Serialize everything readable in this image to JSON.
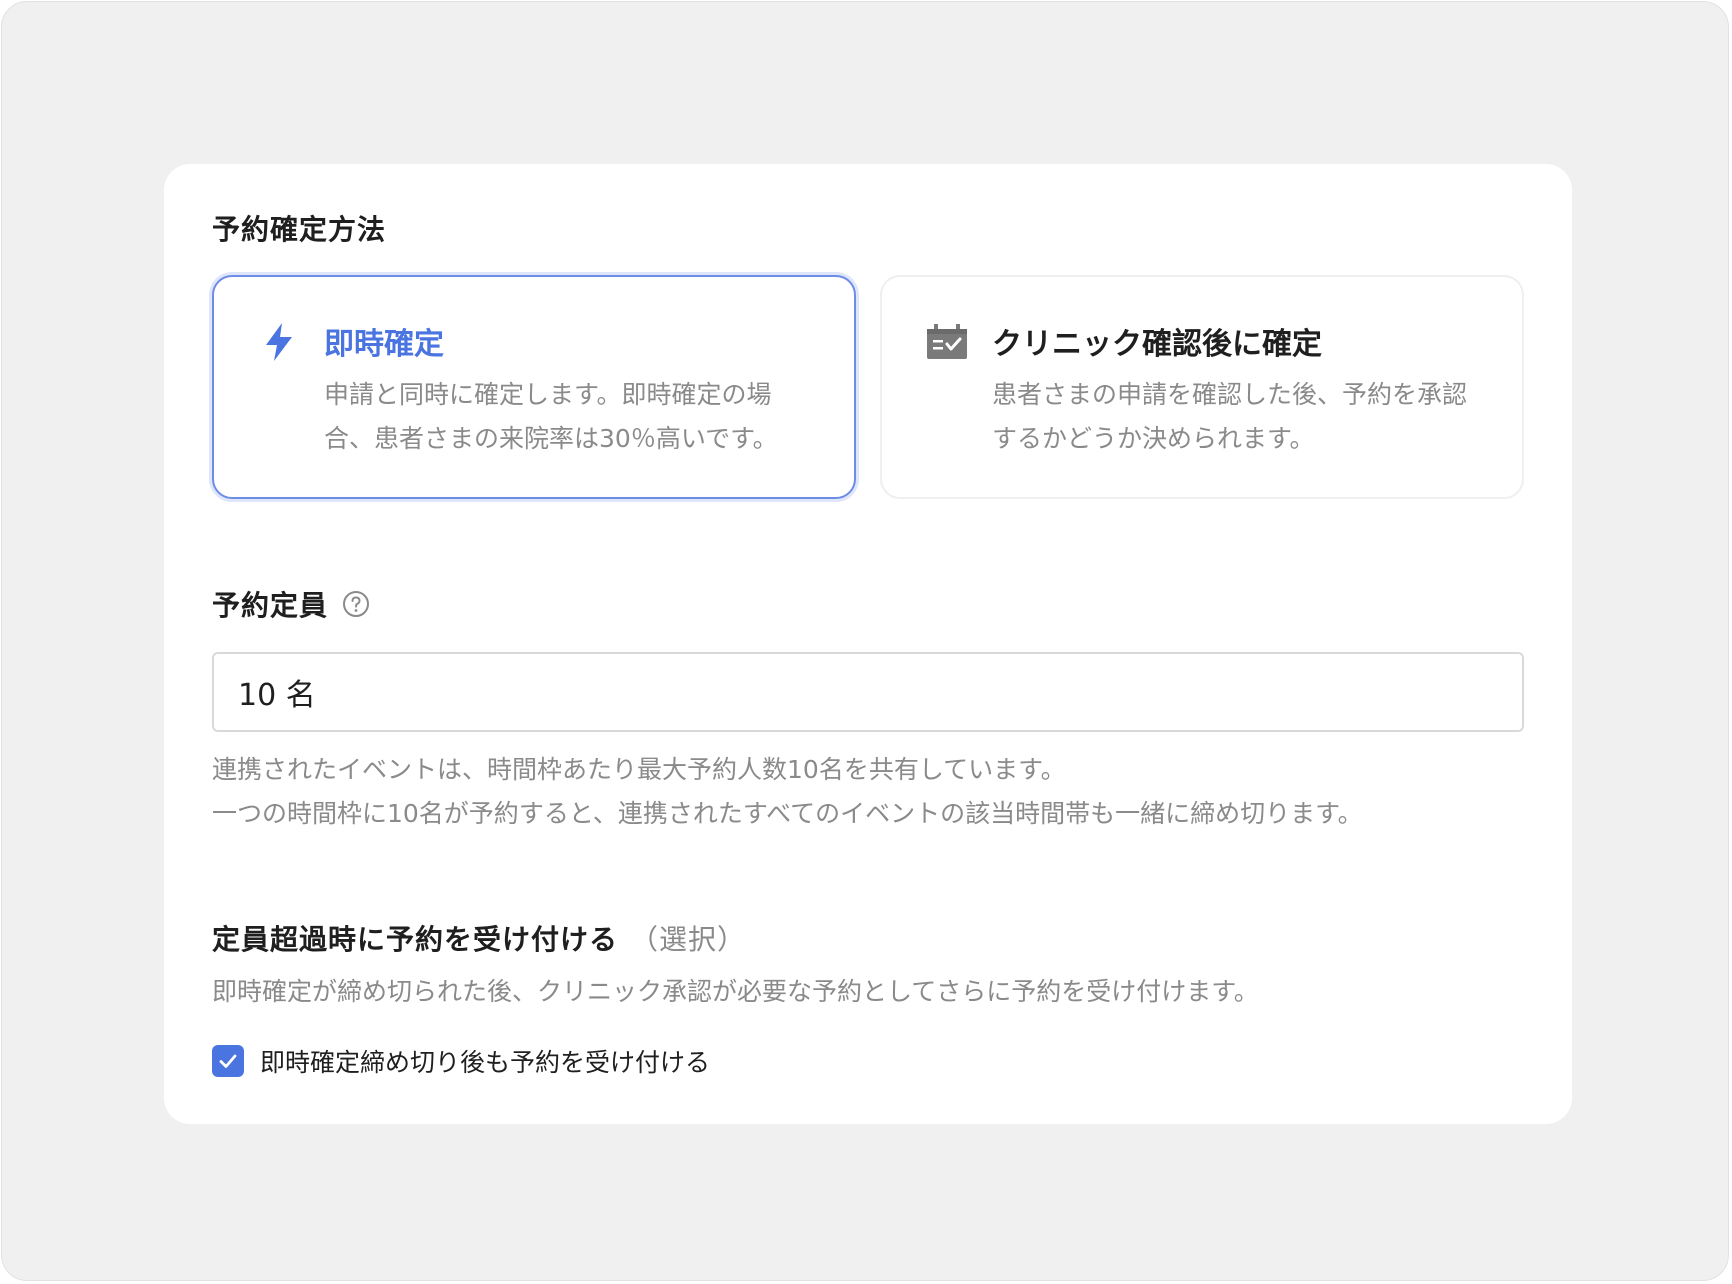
{
  "booking_method": {
    "title": "予約確定方法",
    "options": [
      {
        "title": "即時確定",
        "description": "申請と同時に確定します。即時確定の場合、患者さまの来院率は30％高いです。",
        "icon": "lightning-icon",
        "selected": true
      },
      {
        "title": "クリニック確認後に確定",
        "description": "患者さまの申請を確認した後、予約を承認するかどうか決められます。",
        "icon": "calendar-check-icon",
        "selected": false
      }
    ]
  },
  "capacity": {
    "title": "予約定員",
    "help_icon": "question-circle-icon",
    "value": "10 名",
    "help_lines": [
      "連携されたイベントは、時間枠あたり最大予約人数10名を共有しています。",
      "一つの時間枠に10名が予約すると、連携されたすべてのイベントの該当時間帯も一緒に締め切ります。"
    ]
  },
  "overbooking": {
    "title": "定員超過時に予約を受け付ける",
    "optional_label": "（選択）",
    "description": "即時確定が締め切られた後、クリニック承認が必要な予約としてさらに予約を受け付けます。",
    "checkbox_label": "即時確定締め切り後も予約を受け付ける",
    "checked": true
  },
  "colors": {
    "accent": "#4a74e0",
    "muted_text": "#8a8a8a",
    "background": "#f0f0f0"
  }
}
